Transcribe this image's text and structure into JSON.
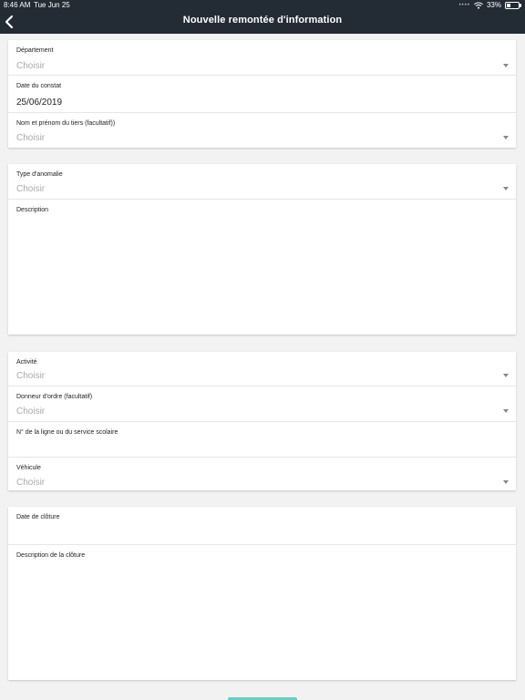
{
  "status_bar": {
    "time": "8:46 AM",
    "date": "Tue Jun 25",
    "battery": "33%",
    "battery_level": 0.33
  },
  "header": {
    "title": "Nouvelle remontée d'information",
    "back_icon": "chevron-left-icon"
  },
  "section1": {
    "departement": {
      "label": "Département",
      "value": "Choisir"
    },
    "date_constat": {
      "label": "Date du constat",
      "value": "25/06/2019"
    },
    "nom_tiers": {
      "label": "Nom et prénom du tiers (facultatif))",
      "value": "Choisir"
    }
  },
  "section2": {
    "type_anomalie": {
      "label": "Type d'anomalie",
      "value": "Choisir"
    },
    "description": {
      "label": "Description",
      "value": ""
    }
  },
  "section3": {
    "activite": {
      "label": "Activité",
      "value": "Choisir"
    },
    "donneur_ordre": {
      "label": "Donneur d'ordre (facultatif)",
      "value": "Choisir"
    },
    "num_ligne": {
      "label": "N° de la ligne ou du service scolaire",
      "value": ""
    },
    "vehicule": {
      "label": "Véhicule",
      "value": "Choisir"
    }
  },
  "section4": {
    "date_cloture": {
      "label": "Date de clôture",
      "value": ""
    },
    "description_cloture": {
      "label": "Description de la clôture",
      "value": ""
    }
  },
  "colors": {
    "header_bg": "#232b35",
    "page_bg": "#f2f2f2",
    "accent": "#5fd3c8"
  }
}
